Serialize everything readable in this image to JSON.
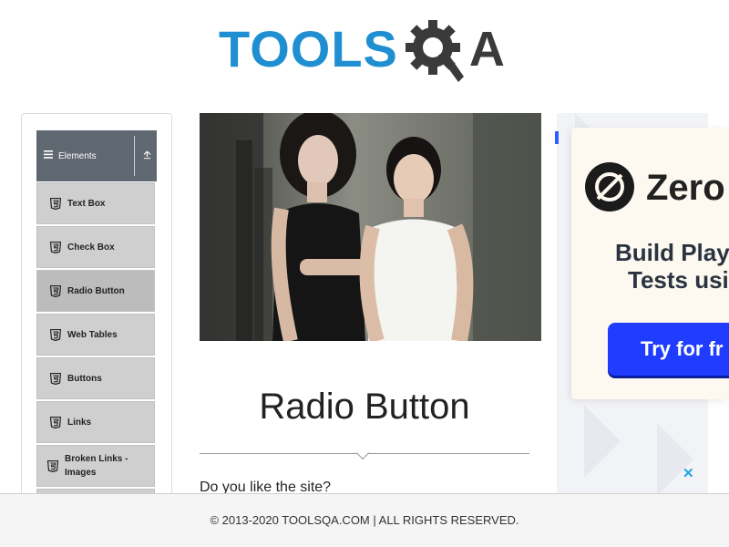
{
  "header": {
    "logo_text_left": "TOOLS",
    "logo_text_right": "A"
  },
  "sidebar": {
    "group_label": "Elements",
    "items": [
      {
        "label": "Text Box",
        "active": false
      },
      {
        "label": "Check Box",
        "active": false
      },
      {
        "label": "Radio Button",
        "active": true
      },
      {
        "label": "Web Tables",
        "active": false
      },
      {
        "label": "Buttons",
        "active": false
      },
      {
        "label": "Links",
        "active": false
      },
      {
        "label": "Broken Links - Images",
        "active": false
      }
    ]
  },
  "main": {
    "title": "Radio Button",
    "question": "Do you like the site?"
  },
  "ad": {
    "brand": "Zero",
    "headline_1": "Build Playw",
    "headline_2": "Tests usi",
    "button_label": "Try for fr",
    "close_glyph": "✕"
  },
  "footer": {
    "copyright": "© 2013-2020 TOOLSQA.COM | ALL RIGHTS RESERVED."
  },
  "colors": {
    "logo_blue": "#1f8fd2",
    "logo_dark": "#3a3a3a",
    "sidebar_header": "#5f6770",
    "menu_item_bg": "#cfcfcf",
    "ad_button": "#1f3cff"
  },
  "icons": {
    "group_menu": "hamburger-icon",
    "group_toggle": "collapse-arrow-icon",
    "menu_item": "html5-icon"
  }
}
